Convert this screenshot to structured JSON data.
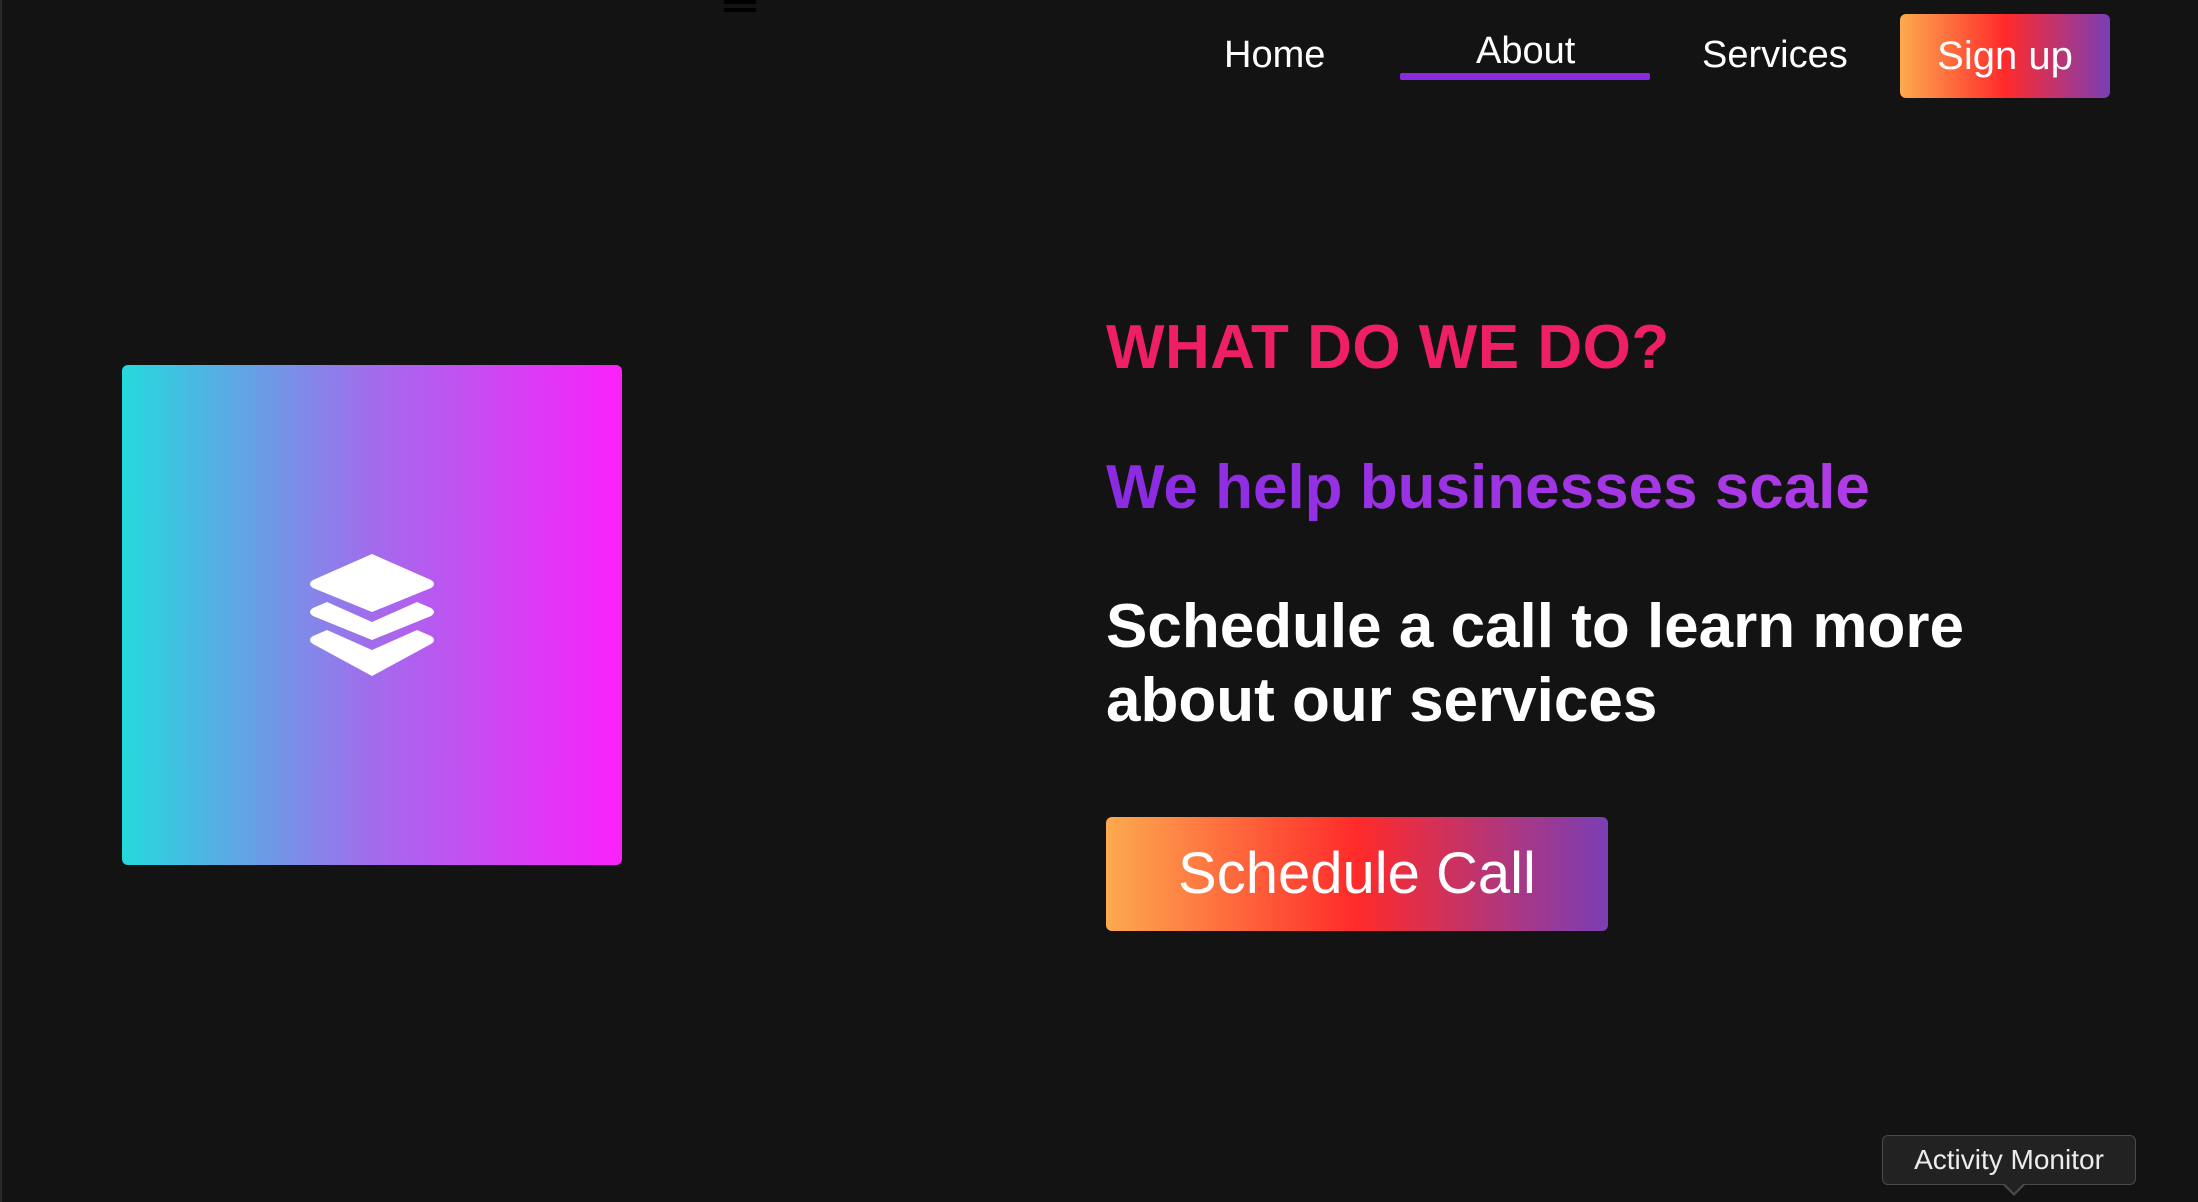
{
  "nav": {
    "menu_icon": "hamburger-icon",
    "links": [
      {
        "label": "Home",
        "active": false
      },
      {
        "label": "About",
        "active": true
      },
      {
        "label": "Services",
        "active": false
      }
    ],
    "signup_label": "Sign up"
  },
  "hero": {
    "tile_icon": "layers-icon",
    "eyebrow": "WHAT DO WE DO?",
    "headline": "We help businesses scale",
    "body": "Schedule a call to learn more about our services",
    "cta_label": "Schedule Call"
  },
  "tooltip": {
    "text": "Activity Monitor"
  },
  "colors": {
    "background": "#131313",
    "eyebrow": "#ef1f66",
    "headline": "#8a2be2",
    "active_underline": "#8a2be2",
    "button_gradient": [
      "#fdaa4f",
      "#ff2a2a",
      "#7a3eb6"
    ],
    "tile_gradient": [
      "#25d9de",
      "#a26cec",
      "#fb20fa"
    ]
  }
}
